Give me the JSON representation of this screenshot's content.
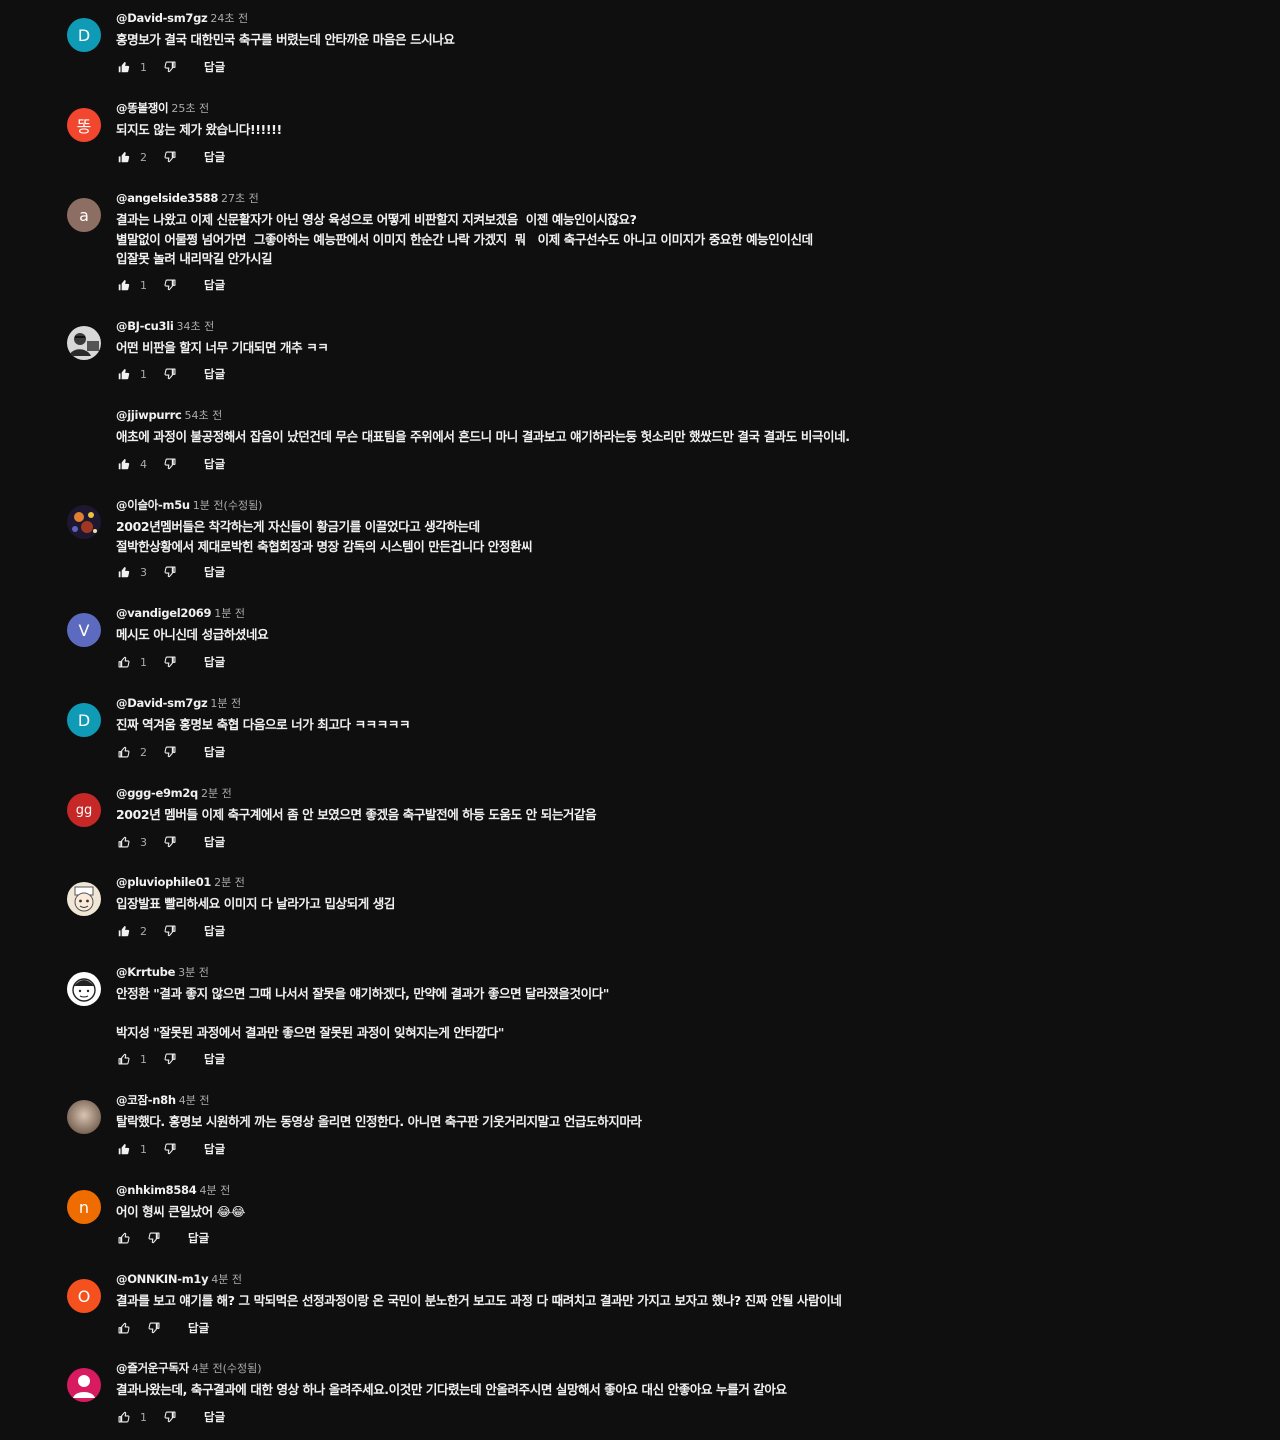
{
  "reply_label": "답글",
  "comments": [
    {
      "author": "@David-sm7gz",
      "time": "24초 전",
      "avatar_letter": "D",
      "avatar_color": "#0f9bb5",
      "lines": [
        "홍명보가 결국 대한민국 축구를 버렸는데 안타까운 마음은 드시나요"
      ],
      "likes": "1",
      "liked": true
    },
    {
      "author": "@똥볼쟁이",
      "time": "25초 전",
      "avatar_letter": "똥",
      "avatar_color": "#f2462e",
      "lines": [
        "되지도 않는 제가 왔습니다!!!!!!"
      ],
      "likes": "2",
      "liked": true
    },
    {
      "author": "@angelside3588",
      "time": "27초 전",
      "avatar_letter": "a",
      "avatar_color": "#8d6e63",
      "lines": [
        "결과는 나왔고 이제 신문활자가 아닌 영상 육성으로 어떻게 비판할지 지켜보겠음  이젠 예능인이시잖요?",
        "별말없이 어물쩡 넘어가면  그좋아하는 예능판에서 이미지 한순간 나락 가겠지  뭐   이제 축구선수도 아니고 이미지가 중요한 예능인이신데",
        "입잘못 놀려 내리막길 안가시길"
      ],
      "likes": "1",
      "liked": true
    },
    {
      "author": "@BJ-cu3li",
      "time": "34초 전",
      "avatar_letter": "",
      "avatar_color": "#c9c9c9",
      "avatar_icon": "profile-photo",
      "lines": [
        "어떤 비판을 할지 너무 기대되면 개추 ㅋㅋ"
      ],
      "likes": "1",
      "liked": true
    },
    {
      "author": "@jjiwpurrc",
      "time": "54초 전",
      "avatar_letter": "",
      "avatar_color": "#0f0f0f",
      "avatar_icon": "blank-avatar",
      "lines": [
        "애초에 과정이 불공정해서 잡음이 났던건데 무슨 대표팀을 주위에서 흔드니 마니 결과보고 얘기하라는둥 헛소리만 했쌌드만 결국 결과도 비극이네."
      ],
      "likes": "4",
      "liked": true
    },
    {
      "author": "@이슬아-m5u",
      "time": "1분 전(수정됨)",
      "avatar_letter": "",
      "avatar_color": "#3a2f4f",
      "avatar_icon": "fireworks-photo",
      "lines": [
        "2002년멤버들은 착각하는게 자신들이 황금기를 이끌었다고 생각하는데",
        "절박한상황에서 제대로박힌 축협회장과 명장 감독의 시스템이 만든겁니다 안정환씨"
      ],
      "likes": "3",
      "liked": true
    },
    {
      "author": "@vandigel2069",
      "time": "1분 전",
      "avatar_letter": "V",
      "avatar_color": "#5c6bc0",
      "lines": [
        "메시도 아니신데 성급하셨네요"
      ],
      "likes": "1",
      "liked": false
    },
    {
      "author": "@David-sm7gz",
      "time": "1분 전",
      "avatar_letter": "D",
      "avatar_color": "#0f9bb5",
      "lines": [
        "진짜 역겨움 홍명보 축협 다음으로 너가 최고다 ㅋㅋㅋㅋㅋ"
      ],
      "likes": "2",
      "liked": false
    },
    {
      "author": "@ggg-e9m2q",
      "time": "2분 전",
      "avatar_letter": "gg",
      "avatar_color": "#c62828",
      "lines": [
        "2002년 멤버들 이제 축구계에서 좀 안 보였으면 좋겠음 축구발전에 하등 도움도 안 되는거같음"
      ],
      "likes": "3",
      "liked": false
    },
    {
      "author": "@pluviophile01",
      "time": "2분 전",
      "avatar_letter": "",
      "avatar_color": "#e8e0d0",
      "avatar_icon": "cartoon-photo",
      "lines": [
        "입장발표 빨리하세요 이미지 다 날라가고 밉상되게 생김"
      ],
      "likes": "2",
      "liked": true
    },
    {
      "author": "@Krrtube",
      "time": "3분 전",
      "avatar_letter": "",
      "avatar_color": "#ffffff",
      "avatar_icon": "drawn-face-photo",
      "lines": [
        "안정환 \"결과 좋지 않으면 그때 나서서 잘못을 얘기하겠다, 만약에 결과가 좋으면 달라졌을것이다\"",
        "",
        "박지성 \"잘못된 과정에서 결과만 좋으면 잘못된 과정이 잊혀지는게 안타깝다\""
      ],
      "likes": "1",
      "liked": false
    },
    {
      "author": "@코잠-n8h",
      "time": "4분 전",
      "avatar_letter": "",
      "avatar_color": "#9e8a7a",
      "avatar_icon": "blurred-photo",
      "lines": [
        "탈락했다. 홍명보 시원하게 까는 동영상 올리면 인정한다. 아니면 축구판 기웃거리지말고 언급도하지마라"
      ],
      "likes": "1",
      "liked": true
    },
    {
      "author": "@nhkim8584",
      "time": "4분 전",
      "avatar_letter": "n",
      "avatar_color": "#ef6c00",
      "lines": [
        "어이 형씨 큰일났어 😂😂"
      ],
      "likes": "",
      "liked": false
    },
    {
      "author": "@ONNKIN-m1y",
      "time": "4분 전",
      "avatar_letter": "O",
      "avatar_color": "#f4511e",
      "lines": [
        "결과를 보고 얘기를 해? 그 막되먹은 선정과정이랑 온 국민이 분노한거 보고도 과정 다 때려치고 결과만 가지고 보자고 했나? 진짜 안될 사람이네"
      ],
      "likes": "",
      "liked": false
    },
    {
      "author": "@즐거운구독자",
      "time": "4분 전(수정됨)",
      "avatar_letter": "",
      "avatar_color": "#d81b60",
      "avatar_icon": "person-icon",
      "lines": [
        "결과나왔는데, 축구결과에 대한 영상 하나 올려주세요.이것만 기다렸는데 안올려주시면 실망해서 좋아요 대신 안좋아요 누를거 같아요"
      ],
      "likes": "1",
      "liked": false
    }
  ]
}
